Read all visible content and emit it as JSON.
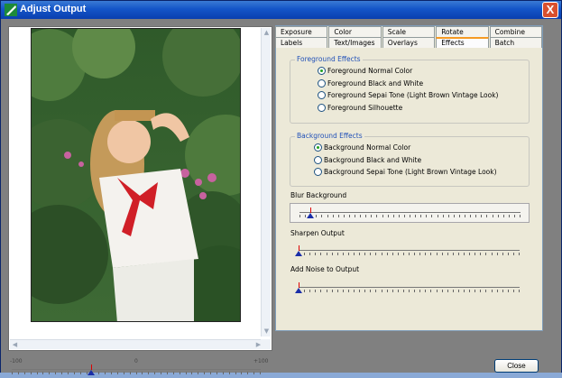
{
  "window": {
    "title": "Adjust Output",
    "close_glyph": "X"
  },
  "tabs_row1": [
    "Exposure",
    "Color",
    "Scale",
    "Rotate",
    "Combine"
  ],
  "tabs_row2": [
    "Labels",
    "Text/Images",
    "Overlays",
    "Effects",
    "Batch"
  ],
  "active_tab": "Effects",
  "foreground": {
    "title": "Foreground Effects",
    "options": [
      {
        "label": "Foreground  Normal Color",
        "selected": true
      },
      {
        "label": "Foreground  Black and White",
        "selected": false
      },
      {
        "label": "Foreground  Sepai Tone (Light Brown Vintage Look)",
        "selected": false
      },
      {
        "label": "Foreground  Silhouette",
        "selected": false
      }
    ]
  },
  "background": {
    "title": "Background Effects",
    "options": [
      {
        "label": "Background  Normal Color",
        "selected": true
      },
      {
        "label": "Background  Black and White",
        "selected": false
      },
      {
        "label": "Background  Sepai Tone (Light Brown Vintage Look)",
        "selected": false
      }
    ]
  },
  "sliders": {
    "blur": {
      "label": "Blur Background",
      "value_fraction": 0.05
    },
    "sharpen": {
      "label": "Sharpen Output",
      "value_fraction": 0.0
    },
    "noise": {
      "label": "Add Noise to Output",
      "value_fraction": 0.0
    }
  },
  "preview_slider": {
    "min_label": "-100",
    "mid_label": "0",
    "max_label": "+100",
    "value_fraction": 0.32
  },
  "buttons": {
    "close": "Close"
  },
  "colors": {
    "title_bar": "#1455c8",
    "accent_tab": "#f59a23",
    "group_title": "#2050b8",
    "thumb": "#1a2ea8"
  }
}
